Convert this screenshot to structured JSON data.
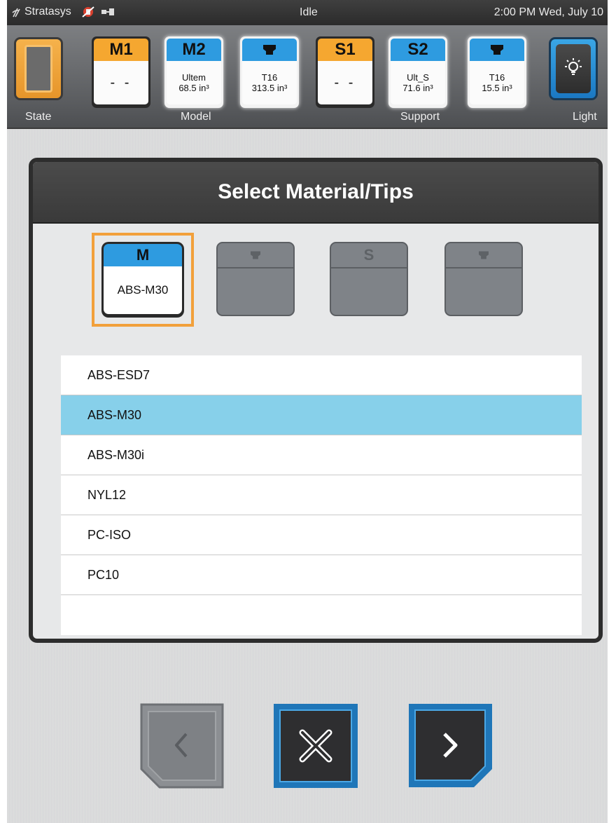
{
  "status_bar": {
    "brand": "Stratasys",
    "state": "Idle",
    "clock": "2:00 PM Wed, July 10"
  },
  "toolbar": {
    "state_label": "State",
    "model_label": "Model",
    "support_label": "Support",
    "light_label": "Light",
    "bays": [
      {
        "cap": "M1",
        "line1": "- -",
        "line2": "",
        "cap_color": "#f5a730"
      },
      {
        "cap": "M2",
        "line1": "Ultem",
        "line2": "68.5 in³",
        "cap_color": "#2e9be0"
      },
      {
        "cap": "tip",
        "line1": "T16",
        "line2": "313.5 in³",
        "cap_color": "#2e9be0"
      },
      {
        "cap": "S1",
        "line1": "- -",
        "line2": "",
        "cap_color": "#f5a730"
      },
      {
        "cap": "S2",
        "line1": "Ult_S",
        "line2": "71.6 in³",
        "cap_color": "#2e9be0"
      },
      {
        "cap": "tip",
        "line1": "T16",
        "line2": "15.5 in³",
        "cap_color": "#2e9be0"
      }
    ]
  },
  "dialog": {
    "title": "Select Material/Tips",
    "slots": [
      {
        "cap": "M",
        "value": "ABS-M30",
        "selected": true
      },
      {
        "cap": "tip-icon",
        "value": ""
      },
      {
        "cap": "S",
        "value": ""
      },
      {
        "cap": "tip-icon",
        "value": ""
      }
    ],
    "materials": [
      "ABS-ESD7",
      "ABS-M30",
      "ABS-M30i",
      "NYL12",
      "PC-ISO",
      "PC10"
    ],
    "selected_material": "ABS-M30"
  },
  "colors": {
    "accent_orange": "#f2a03b",
    "accent_blue": "#2e9be0",
    "selection": "#87d0ea"
  }
}
